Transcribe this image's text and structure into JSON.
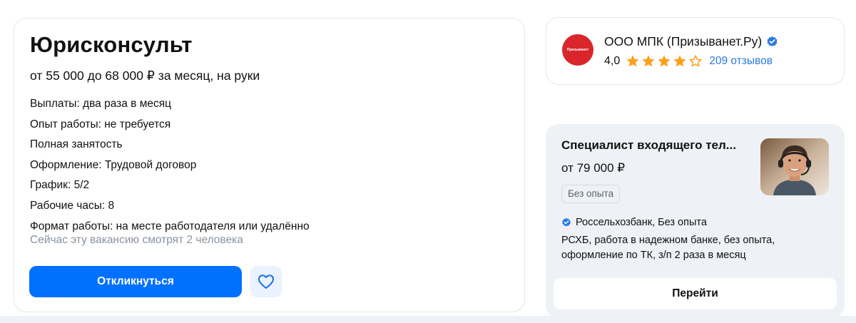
{
  "vacancy": {
    "title": "Юрисконсульт",
    "salary": "от 55 000 до 68 000 ₽ за месяц, на руки",
    "details": [
      "Выплаты: два раза в месяц",
      "Опыт работы: не требуется",
      "Полная занятость",
      "Оформление: Трудовой договор",
      "График: 5/2",
      "Рабочие часы: 8",
      "Формат работы: на месте работодателя или удалённо"
    ],
    "viewers": "Сейчас эту вакансию смотрят 2 человека",
    "apply_label": "Откликнуться",
    "favorite_icon": "heart-icon",
    "accent_color": "#0070ff"
  },
  "company": {
    "name": "ООО МПК (Призыванет.Ру)",
    "logo_text": "Призыванет",
    "logo_color": "#d9262b",
    "verified_icon": "verified-badge-icon",
    "rating": "4,0",
    "stars_filled": 4,
    "stars_total": 5,
    "star_color": "#ff9f1a",
    "reviews": "209 отзывов",
    "link_color": "#2a7ae4"
  },
  "ad": {
    "title": "Специалист входящего тел...",
    "salary": "от 79 000  ₽",
    "tag": "Без опыта",
    "company": "Россельхозбанк, Без опыта",
    "description": "РСХБ, работа в надежном банке, без опыта, оформление по ТК, з/п 2 раза в месяц",
    "go_label": "Перейти",
    "photo": "operator-headset-photo"
  }
}
